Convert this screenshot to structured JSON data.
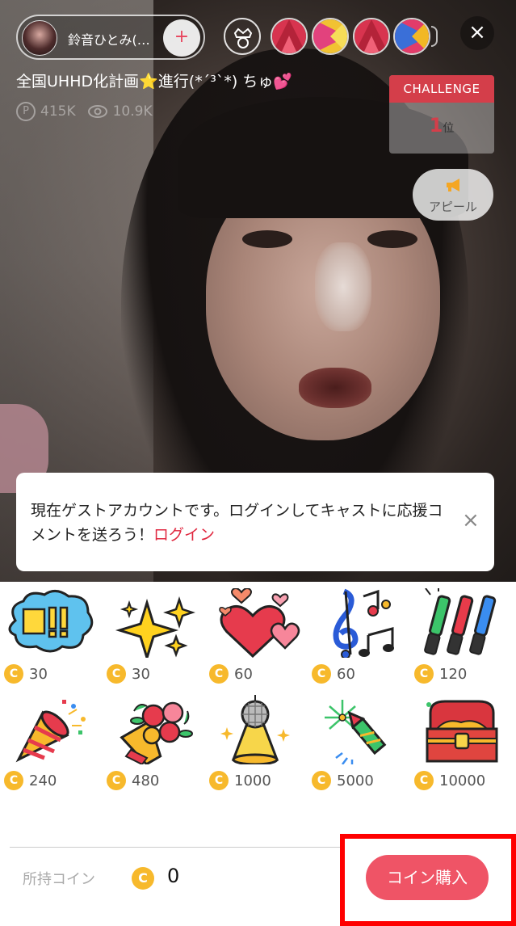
{
  "host": {
    "name": "鈴音ひとみ(…",
    "follow_label": "+"
  },
  "icons": {
    "crown": "crown-icon",
    "close": "close-icon",
    "points": "points-icon",
    "viewers": "eye-icon",
    "megaphone": "megaphone-icon",
    "coin": "coin-icon"
  },
  "close_label": "×",
  "stream": {
    "title": "全国UHHD化計画",
    "title_emoji_star": "⭐",
    "title_rest": "進行(*´³`*) ちゅ",
    "title_emoji_heart": "💕",
    "points_badge": "P",
    "points": "415K",
    "viewers": "10.9K"
  },
  "challenge": {
    "header": "CHALLENGE",
    "rank": "1",
    "rank_suffix": "位"
  },
  "appeal": {
    "label": "アピール"
  },
  "guest_banner": {
    "message": "現在ゲストアカウントです。ログインしてキャストに応援コメントを送ろう！",
    "login_link": "ログイン",
    "close": "×"
  },
  "gifts": [
    {
      "icon": "laugh-bubble-icon",
      "price": "30"
    },
    {
      "icon": "sparkles-icon",
      "price": "30"
    },
    {
      "icon": "hearts-icon",
      "price": "60"
    },
    {
      "icon": "music-notes-icon",
      "price": "60"
    },
    {
      "icon": "glow-sticks-icon",
      "price": "120"
    },
    {
      "icon": "party-popper-icon",
      "price": "240"
    },
    {
      "icon": "bouquet-icon",
      "price": "480"
    },
    {
      "icon": "disco-ball-icon",
      "price": "1000"
    },
    {
      "icon": "fireworks-rocket-icon",
      "price": "5000"
    },
    {
      "icon": "treasure-chest-icon",
      "price": "10000"
    }
  ],
  "coin_symbol": "C",
  "wallet": {
    "label": "所持コイン",
    "balance": "0"
  },
  "buy_button": {
    "label": "コイン購入"
  },
  "colors": {
    "accent": "#ef5466",
    "challenge_red": "#d43e4a",
    "coin": "#f7b92c",
    "highlight": "#ff0000"
  }
}
